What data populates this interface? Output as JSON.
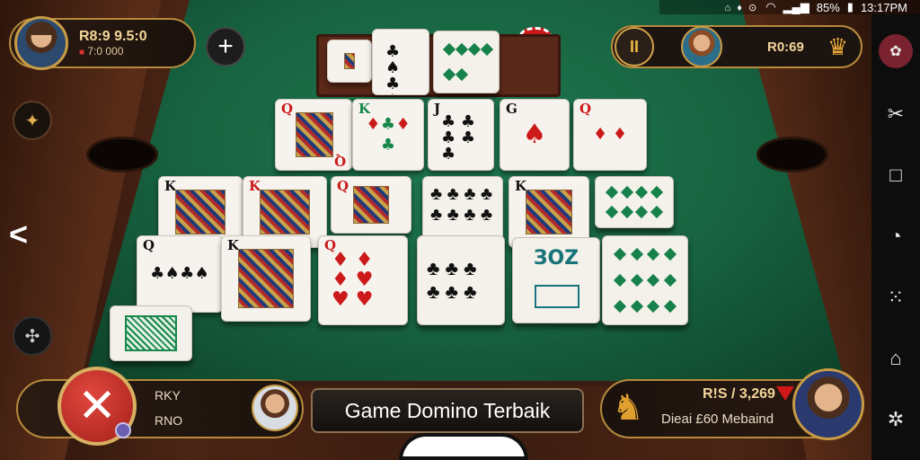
{
  "status_bar": {
    "icons": [
      "wifi-icon",
      "signal-icon",
      "battery-icon"
    ],
    "battery": "85%",
    "time": "13:17PM"
  },
  "top_left_player": {
    "balance": "R8:9 9.5:0",
    "sub_balance": "7:0 000",
    "add_label": "+"
  },
  "top_right_player": {
    "pause_label": "II",
    "value": "R0:69"
  },
  "title": "Game Domino Terbaik",
  "bottom_left": {
    "line1": "RKY",
    "line2": "RNO",
    "close_label": "✕"
  },
  "bottom_right": {
    "amount": "R!S / 3,269",
    "name": "Dieai £60 Mebaind"
  },
  "nav": {
    "items": [
      "butterfly-icon",
      "tools-icon",
      "square-icon",
      "gauge-icon",
      "grid-icon",
      "home-icon",
      "settings-icon"
    ]
  },
  "colors": {
    "felt": "#17613f",
    "gold_border": "#b78a3c",
    "close_red": "#c42d25"
  }
}
